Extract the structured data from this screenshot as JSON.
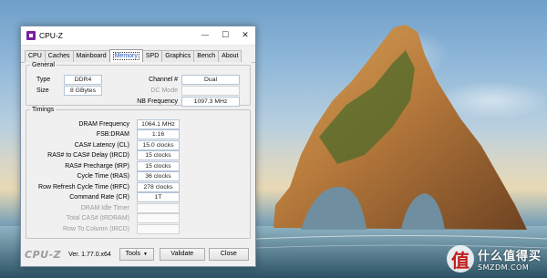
{
  "window": {
    "title": "CPU-Z",
    "controls": {
      "minimize": "—",
      "maximize": "☐",
      "close": "✕"
    }
  },
  "tabs": [
    "CPU",
    "Caches",
    "Mainboard",
    "Memory",
    "SPD",
    "Graphics",
    "Bench",
    "About"
  ],
  "active_tab": "Memory",
  "general": {
    "legend": "General",
    "type_label": "Type",
    "type_value": "DDR4",
    "size_label": "Size",
    "size_value": "8 GBytes",
    "channel_label": "Channel #",
    "channel_value": "Dual",
    "dc_mode_label": "DC Mode",
    "dc_mode_value": "",
    "nb_freq_label": "NB Frequency",
    "nb_freq_value": "1097.3 MHz"
  },
  "timings": {
    "legend": "Timings",
    "rows": [
      {
        "label": "DRAM Frequency",
        "value": "1064.1 MHz",
        "enabled": true
      },
      {
        "label": "FSB:DRAM",
        "value": "1:16",
        "enabled": true
      },
      {
        "label": "CAS# Latency (CL)",
        "value": "15.0 clocks",
        "enabled": true
      },
      {
        "label": "RAS# to CAS# Delay (tRCD)",
        "value": "15 clocks",
        "enabled": true
      },
      {
        "label": "RAS# Precharge (tRP)",
        "value": "15 clocks",
        "enabled": true
      },
      {
        "label": "Cycle Time (tRAS)",
        "value": "36 clocks",
        "enabled": true
      },
      {
        "label": "Row Refresh Cycle Time (tRFC)",
        "value": "278 clocks",
        "enabled": true
      },
      {
        "label": "Command Rate (CR)",
        "value": "1T",
        "enabled": true
      },
      {
        "label": "DRAM Idle Timer",
        "value": "",
        "enabled": false
      },
      {
        "label": "Total CAS# (tRDRAM)",
        "value": "",
        "enabled": false
      },
      {
        "label": "Row To Column (tRCD)",
        "value": "",
        "enabled": false
      }
    ]
  },
  "footer": {
    "brand": "CPU-Z",
    "version": "Ver. 1.77.0.x64",
    "tools_label": "Tools",
    "validate_label": "Validate",
    "close_label": "Close"
  },
  "watermark": {
    "cn": "什么值得买",
    "en": "SMZDM.COM",
    "badge": "值"
  }
}
